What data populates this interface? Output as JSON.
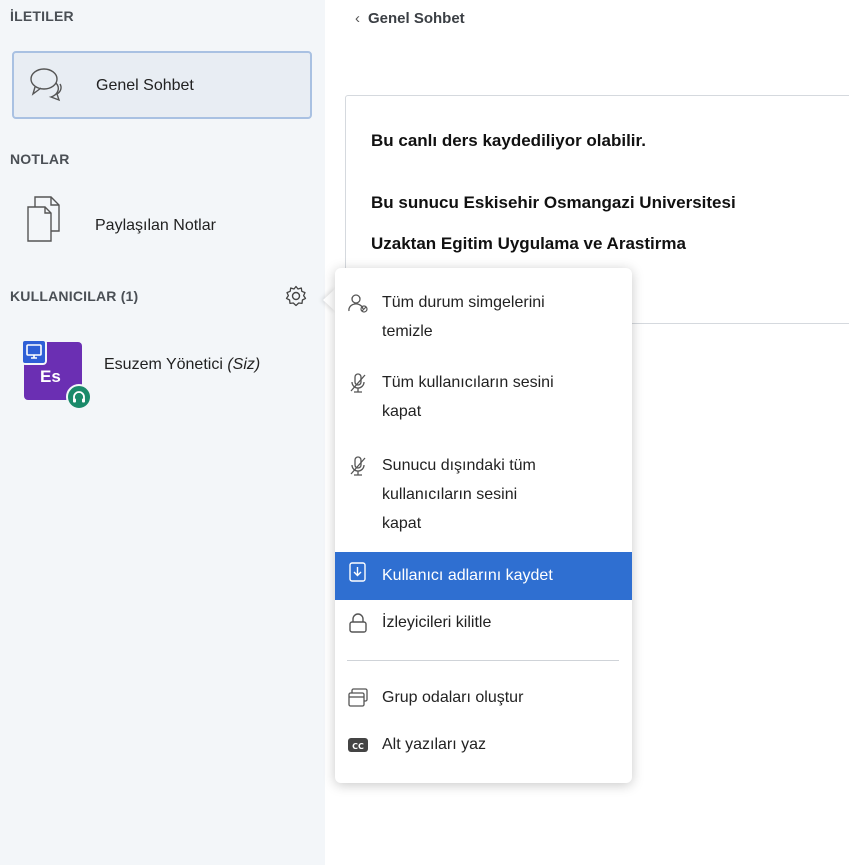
{
  "sidebar": {
    "messages_title": "İLETILER",
    "chat_label": "Genel Sohbet",
    "notes_title": "NOTLAR",
    "notes_label": "Paylaşılan Notlar",
    "users_title": "KULLANICILAR (1)",
    "user": {
      "initials": "Es",
      "name": "Esuzem Yönetici",
      "suffix": "(Siz)"
    }
  },
  "main": {
    "back_title": "Genel Sohbet",
    "welcome_line1": "Bu canlı ders kaydediliyor olabilir.",
    "welcome_line2": "Bu sunucu Eskisehir Osmangazi Universitesi",
    "welcome_line3": "Uzaktan Egitim Uygulama ve Arastirma"
  },
  "menu": {
    "items": [
      {
        "label_l1": "Tüm durum simgelerini",
        "label_l2": "temizle",
        "icon": "clear-status-icon"
      },
      {
        "label_l1": "Tüm kullanıcıların sesini",
        "label_l2": "kapat",
        "icon": "mute-icon"
      },
      {
        "label_l1": "Sunucu dışındaki tüm",
        "label_l2": "kullanıcıların sesini",
        "label_l3": "kapat",
        "icon": "mute-icon"
      },
      {
        "label": "Kullanıcı adlarını kaydet",
        "icon": "download-icon",
        "active": true
      },
      {
        "label": "İzleyicileri kilitle",
        "icon": "lock-icon"
      },
      {
        "label": "Grup odaları oluştur",
        "icon": "rooms-icon"
      },
      {
        "label": "Alt yazıları yaz",
        "icon": "cc-icon"
      }
    ]
  },
  "colors": {
    "accent": "#2f6fd1",
    "avatar": "#6b2fb3",
    "sidebar_bg": "#f3f6f9"
  }
}
